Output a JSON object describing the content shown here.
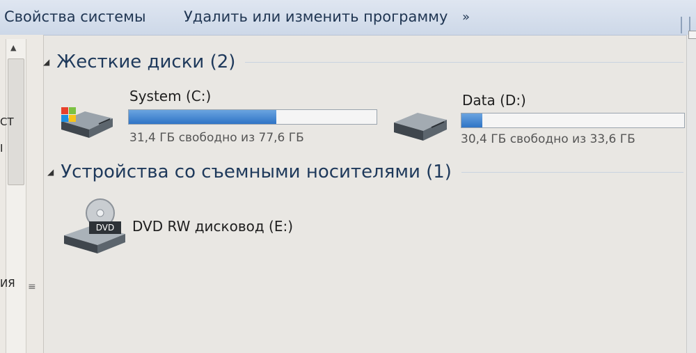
{
  "toolbar": {
    "system_properties": "Свойства системы",
    "uninstall_program": "Удалить или изменить программу",
    "more": "»"
  },
  "nav": {
    "stub_1": "СТ",
    "stub_2": "I",
    "stub_3": "ИЯ"
  },
  "groups": {
    "hard_disks": {
      "title": "Жесткие диски (2)",
      "drives": [
        {
          "name": "System (C:)",
          "info": "31,4 ГБ свободно из 77,6 ГБ",
          "used_fraction": 0.595,
          "icon": "windows-hdd-icon"
        },
        {
          "name": "Data (D:)",
          "info": "30,4 ГБ свободно из 33,6 ГБ",
          "used_fraction": 0.095,
          "icon": "hdd-icon"
        }
      ]
    },
    "removable": {
      "title": "Устройства со съемными носителями (1)",
      "drives": [
        {
          "name": "DVD RW дисковод (E:)",
          "icon": "dvd-drive-icon",
          "badge": "DVD"
        }
      ]
    }
  }
}
